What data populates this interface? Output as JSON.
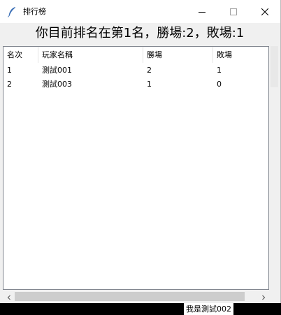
{
  "window": {
    "title": "排行榜",
    "icon": "feather-icon",
    "controls": {
      "minimize": "minimize-icon",
      "maximize": "maximize-icon",
      "close": "close-icon"
    }
  },
  "headline": "你目前排名在第1名，勝場:2，敗場:1",
  "table": {
    "columns": [
      "名次",
      "玩家名稱",
      "勝場",
      "敗場"
    ],
    "rows": [
      [
        "1",
        "測試001",
        "2",
        "1"
      ],
      [
        "2",
        "測試003",
        "1",
        "0"
      ]
    ]
  },
  "status_text": "我是測試002",
  "colors": {
    "window_bg": "#f0f0f0",
    "titlebar_bg": "#ffffff",
    "desktop_bg": "#000000"
  }
}
